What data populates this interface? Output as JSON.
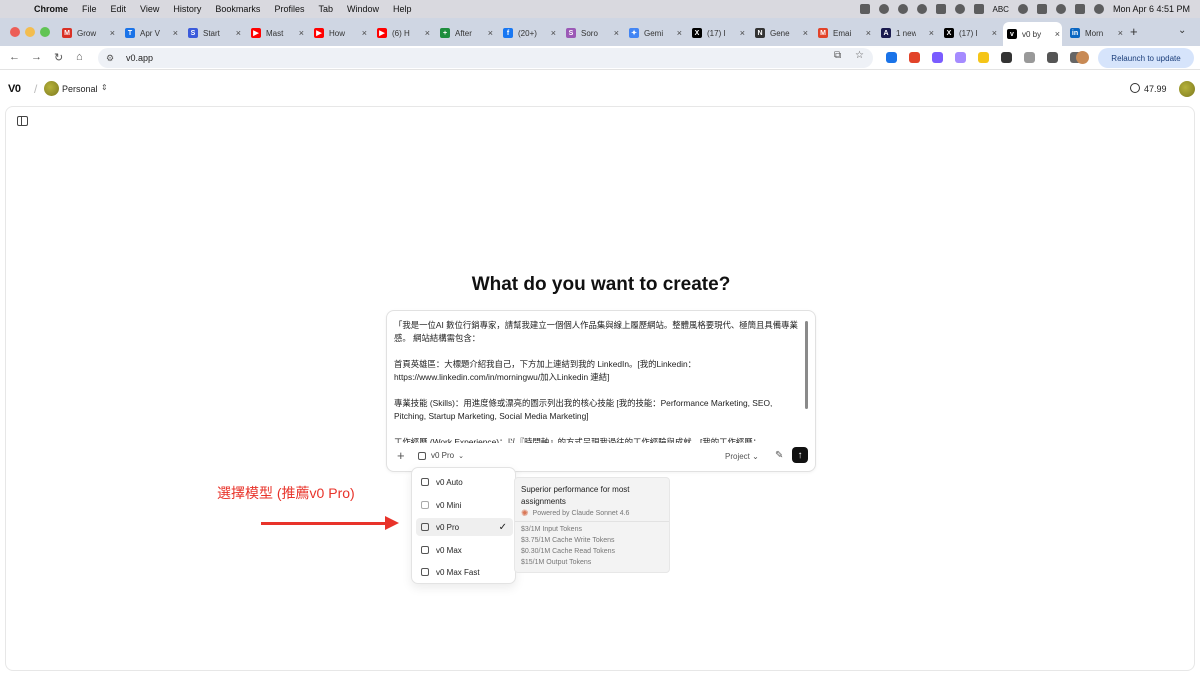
{
  "menubar": {
    "app": "Chrome",
    "items": [
      "File",
      "Edit",
      "View",
      "History",
      "Bookmarks",
      "Profiles",
      "Tab",
      "Window",
      "Help"
    ],
    "input_indicator": "ABC",
    "clock": "Mon Apr 6  4:51 PM"
  },
  "tabs": [
    {
      "label": "Grow",
      "color": "#d93025",
      "glyph": "M"
    },
    {
      "label": "Apr V",
      "color": "#1a73e8",
      "glyph": "T"
    },
    {
      "label": "Start",
      "color": "#3b5bdb",
      "glyph": "S"
    },
    {
      "label": "Mast",
      "color": "#ff0000",
      "glyph": "▶"
    },
    {
      "label": "How",
      "color": "#ff0000",
      "glyph": "▶"
    },
    {
      "label": "(6) H",
      "color": "#ff0000",
      "glyph": "▶"
    },
    {
      "label": "After",
      "color": "#1e8e3e",
      "glyph": "+"
    },
    {
      "label": "(20+)",
      "color": "#1877f2",
      "glyph": "f"
    },
    {
      "label": "Soro",
      "color": "#9b59b6",
      "glyph": "S"
    },
    {
      "label": "Gemi",
      "color": "#4285f4",
      "glyph": "✦"
    },
    {
      "label": "(17) I",
      "color": "#000000",
      "glyph": "X"
    },
    {
      "label": "Gene",
      "color": "#333333",
      "glyph": "N"
    },
    {
      "label": "Emai",
      "color": "#e24329",
      "glyph": "M"
    },
    {
      "label": "1 new",
      "color": "#1a1a4e",
      "glyph": "A"
    },
    {
      "label": "(17) I",
      "color": "#000000",
      "glyph": "X"
    },
    {
      "label": "v0 by",
      "color": "#000000",
      "glyph": "v",
      "active": true
    },
    {
      "label": "Morn",
      "color": "#0a66c2",
      "glyph": "in"
    }
  ],
  "toolbar": {
    "url": "v0.app",
    "relaunch_label": "Relaunch to update",
    "extension_colors": [
      "#1a73e8",
      "#e24329",
      "#7a5cff",
      "#a58bff",
      "#f5c518",
      "#333333",
      "#999999",
      "#555555",
      "#666666"
    ]
  },
  "header": {
    "logo": "V0",
    "workspace": "Personal",
    "credits": "47.99"
  },
  "main": {
    "title": "What do you want to create?",
    "prompt_text": "「我是一位AI 數位行銷專家，請幫我建立一個個人作品集與線上履歷網站。整體風格要現代、極簡且具備專業感。 網站結構需包含：\n\n首頁英雄區：大標題介紹我自己，下方加上連結到我的 LinkedIn。[我的Linkedin：https://www.linkedin.com/in/morningwu/加入Linkedin 連結]\n\n專業技能 (Skills)：用進度條或漂亮的圖示列出我的核心技能 [我的技能：Performance Marketing, SEO, Pitching, Startup Marketing, Social Media Marketing]\n\n工作經歷 (Work Experience)：以『時間軸』的方式呈現我過往的工作經驗與成就。[我的工作經歷：",
    "model_button": "v0 Pro",
    "project_button": "Project"
  },
  "model_menu": {
    "items": [
      {
        "label": "v0 Auto"
      },
      {
        "label": "v0 Mini"
      },
      {
        "label": "v0 Pro",
        "selected": true
      },
      {
        "label": "v0 Max"
      },
      {
        "label": "v0 Max Fast"
      }
    ],
    "checkmark": "✓"
  },
  "model_info": {
    "title": "Superior performance for most assignments",
    "powered_by": "Powered by Claude Sonnet 4.6",
    "prices": [
      "$3/1M Input Tokens",
      "$3.75/1M Cache Write Tokens",
      "$0.30/1M Cache Read Tokens",
      "$15/1M Output Tokens"
    ]
  },
  "annotation": {
    "text": "選擇模型 (推薦v0 Pro)",
    "color": "#e8332a"
  }
}
